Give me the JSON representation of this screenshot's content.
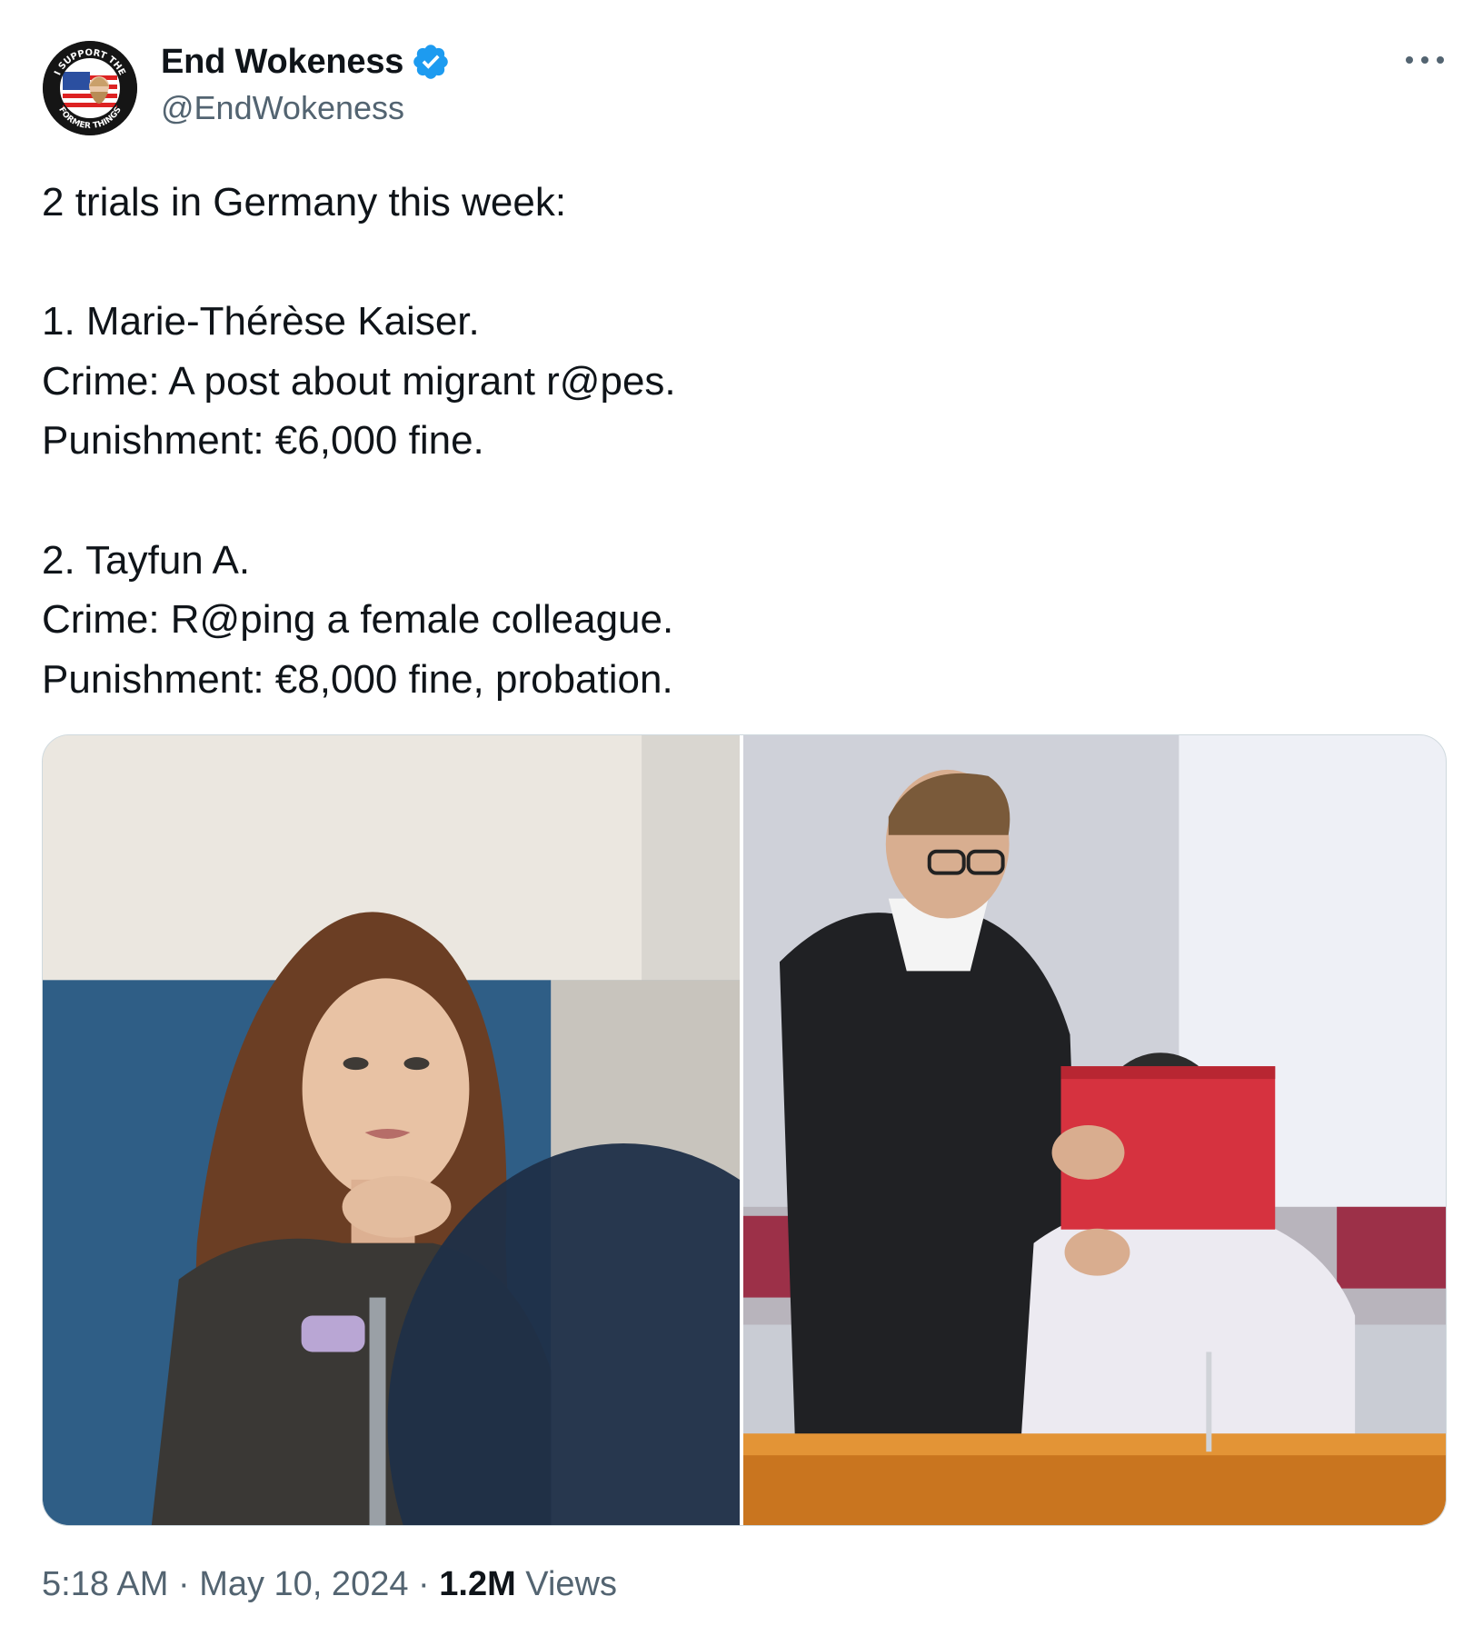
{
  "author": {
    "display_name": "End Wokeness",
    "handle": "@EndWokeness",
    "verified": true,
    "verified_color": "#1d9bf0",
    "avatar_text_top": "I SUPPORT THE",
    "avatar_text_bottom": "FORMER THINGS"
  },
  "more_icon": "more-horizontal-icon",
  "tweet_lines": [
    "2 trials in Germany this week:",
    "",
    "1. Marie-Thérèse Kaiser.",
    "Crime: A post about migrant r@pes.",
    "Punishment: €6,000 fine.",
    "",
    "2. Tayfun A.",
    "Crime: R@ping a female colleague.",
    "Punishment: €8,000 fine, probation."
  ],
  "media": [
    {
      "name": "photo-woman-in-meeting"
    },
    {
      "name": "photo-lawyer-and-defendant-with-red-folder"
    }
  ],
  "meta": {
    "time": "5:18 AM",
    "separator": " · ",
    "date": "May 10, 2024",
    "views_count": "1.2M",
    "views_label": " Views"
  },
  "colors": {
    "text": "#0f1419",
    "secondary": "#536471",
    "border": "#cfd9de",
    "accent": "#1d9bf0"
  }
}
